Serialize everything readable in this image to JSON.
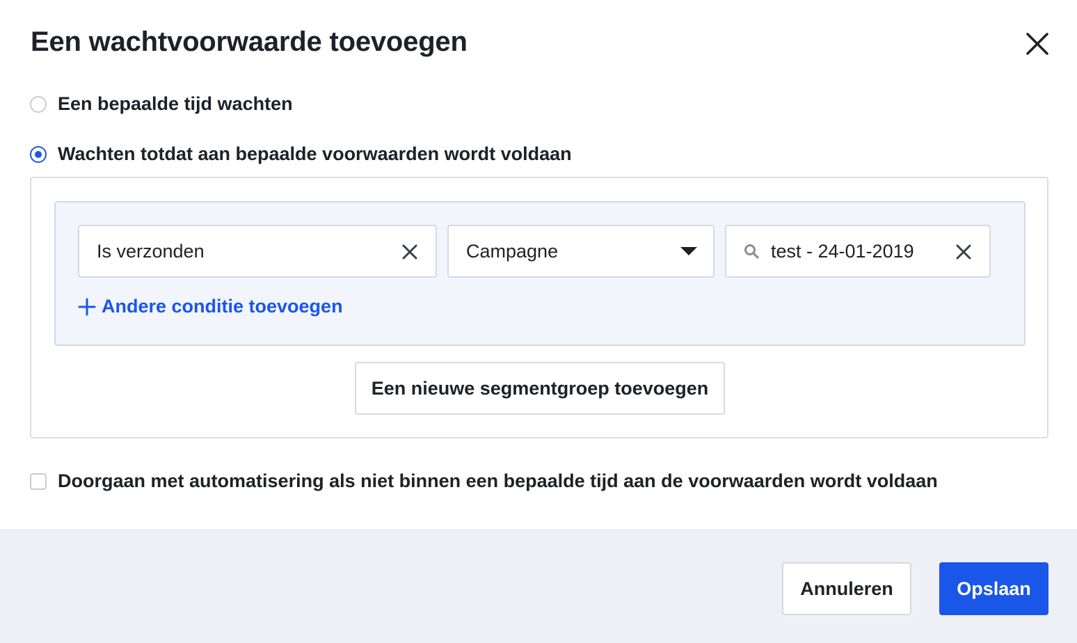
{
  "dialog": {
    "title": "Een wachtvoorwaarde toevoegen",
    "close_icon": "close-icon"
  },
  "options": {
    "wait_time_label": "Een bepaalde tijd wachten",
    "wait_time_selected": false,
    "wait_conditions_label": "Wachten totdat aan bepaalde voorwaarden wordt voldaan",
    "wait_conditions_selected": true
  },
  "condition": {
    "action_value": "Is verzonden",
    "type_value": "Campagne",
    "campaign_value": "test - 24-01-2019",
    "icons": [
      "clear-icon",
      "caret-down-icon",
      "search-icon",
      "plus-icon"
    ]
  },
  "add_condition_label": "Andere conditie toevoegen",
  "add_segment_group_label": "Een nieuwe segmentgroep toevoegen",
  "continue_checkbox": {
    "label": "Doorgaan met automatisering als niet binnen een bepaalde tijd aan de voorwaarden wordt voldaan",
    "checked": false
  },
  "footer": {
    "cancel_label": "Annuleren",
    "save_label": "Opslaan"
  },
  "colors": {
    "accent": "#1a56e8",
    "text": "#1f2129",
    "footer_bg": "#eef0f5",
    "group_bg": "#f2f5fc"
  }
}
